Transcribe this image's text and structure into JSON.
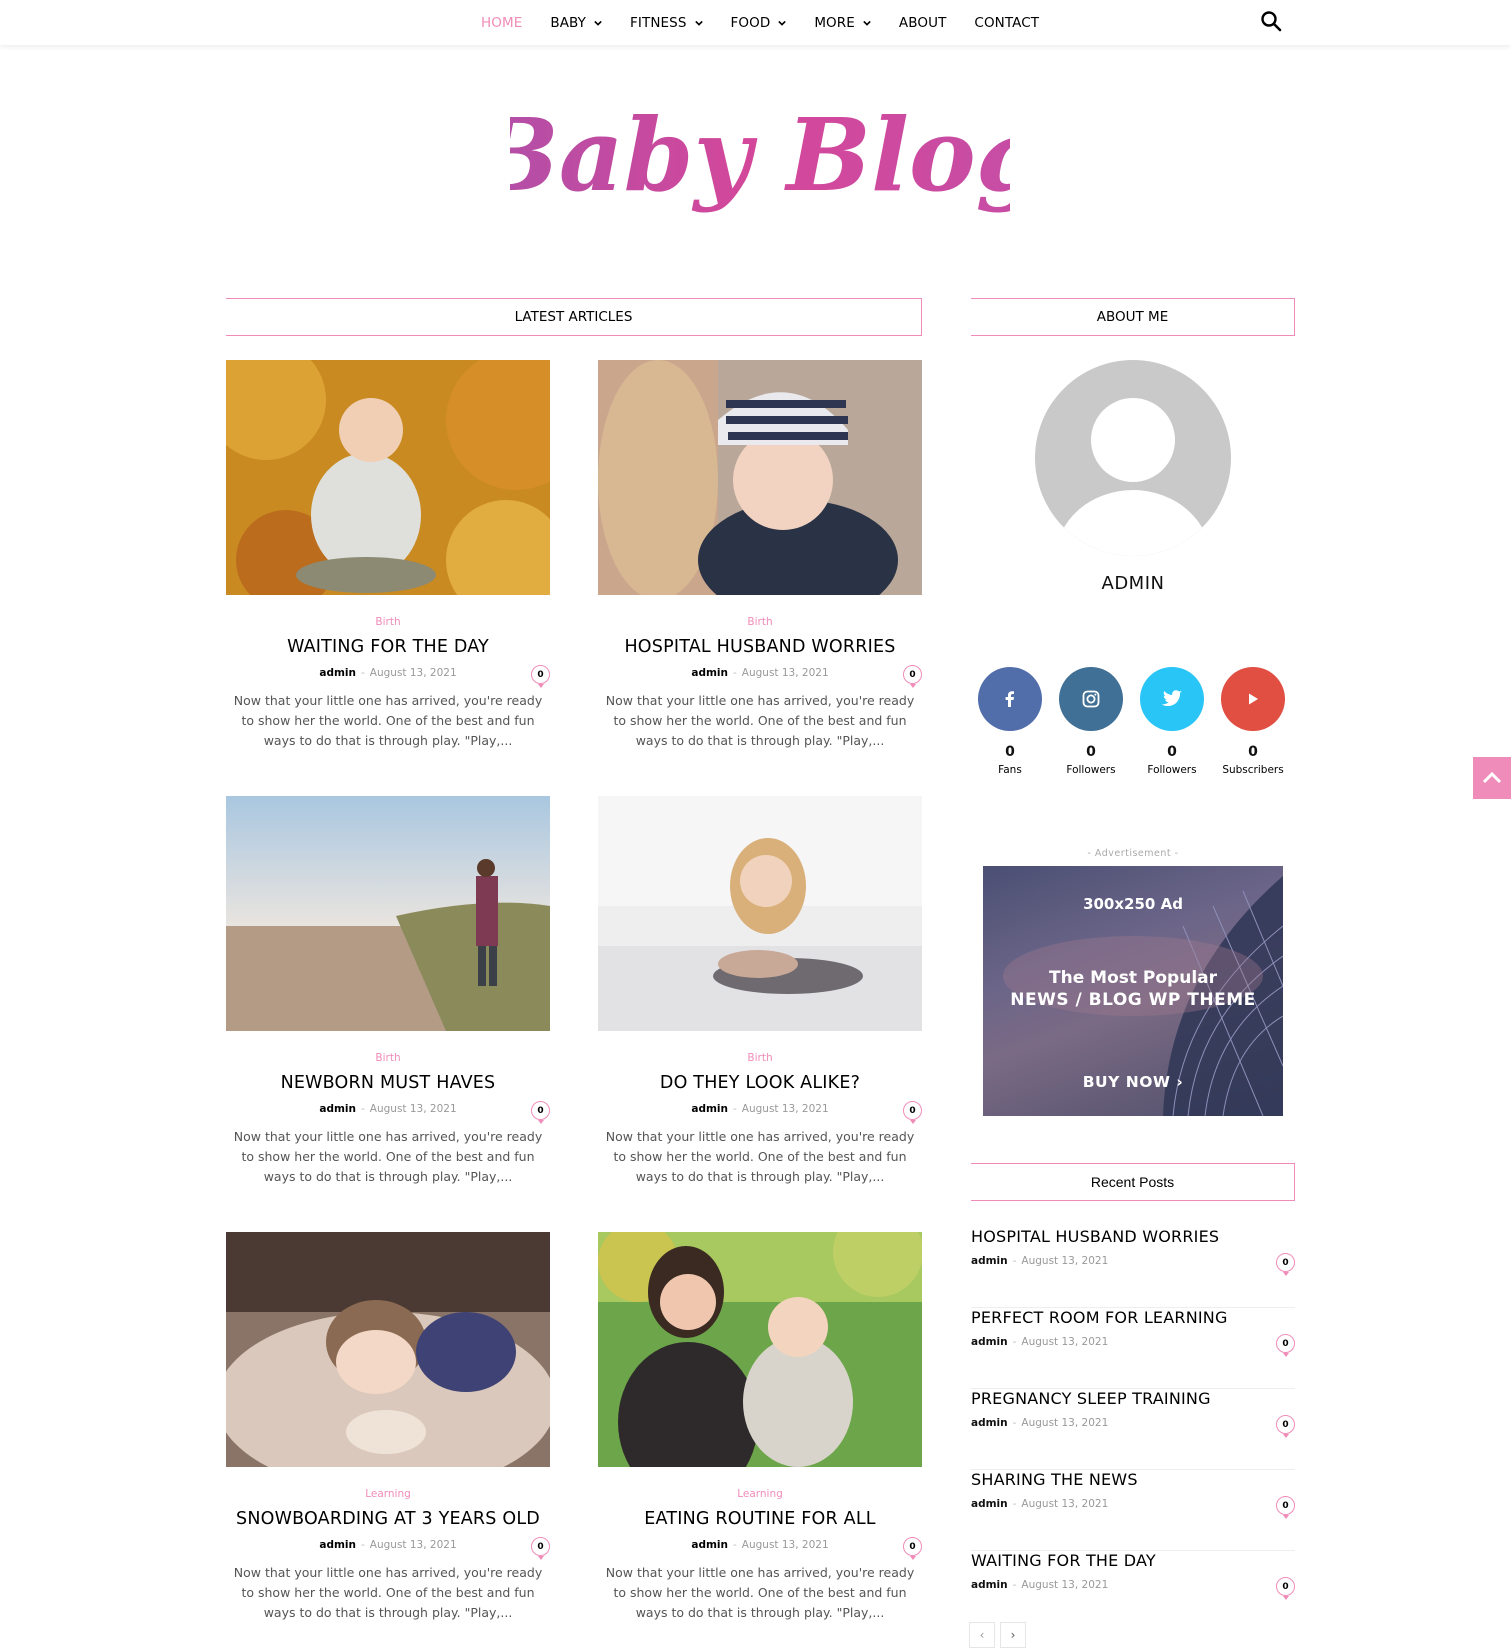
{
  "nav": {
    "items": [
      {
        "label": "HOME",
        "active": true,
        "dropdown": false
      },
      {
        "label": "BABY",
        "active": false,
        "dropdown": true
      },
      {
        "label": "FITNESS",
        "active": false,
        "dropdown": true
      },
      {
        "label": "FOOD",
        "active": false,
        "dropdown": true
      },
      {
        "label": "MORE",
        "active": false,
        "dropdown": true
      },
      {
        "label": "ABOUT",
        "active": false,
        "dropdown": false
      },
      {
        "label": "CONTACT",
        "active": false,
        "dropdown": false
      }
    ],
    "search_icon": "search-icon"
  },
  "logo": {
    "text": "Baby Blog"
  },
  "colors": {
    "accent": "#f08cb9",
    "facebook": "#516eab",
    "instagram": "#417096",
    "twitter": "#29c5f6",
    "youtube": "#e14e42"
  },
  "latest": {
    "title": "LATEST ARTICLES",
    "articles": [
      {
        "category": "Birth",
        "title": "WAITING FOR THE DAY",
        "author": "admin",
        "date": "August 13, 2021",
        "comments": "0",
        "excerpt": "Now that your little one has arrived, you're ready to show her the world. One of the best and fun ways to do that is through play. \"Play,..."
      },
      {
        "category": "Birth",
        "title": "HOSPITAL HUSBAND WORRIES",
        "author": "admin",
        "date": "August 13, 2021",
        "comments": "0",
        "excerpt": "Now that your little one has arrived, you're ready to show her the world. One of the best and fun ways to do that is through play. \"Play,..."
      },
      {
        "category": "Birth",
        "title": "NEWBORN MUST HAVES",
        "author": "admin",
        "date": "August 13, 2021",
        "comments": "0",
        "excerpt": "Now that your little one has arrived, you're ready to show her the world. One of the best and fun ways to do that is through play. \"Play,..."
      },
      {
        "category": "Birth",
        "title": "DO THEY LOOK ALIKE?",
        "author": "admin",
        "date": "August 13, 2021",
        "comments": "0",
        "excerpt": "Now that your little one has arrived, you're ready to show her the world. One of the best and fun ways to do that is through play. \"Play,..."
      },
      {
        "category": "Learning",
        "title": "SNOWBOARDING AT 3 YEARS OLD",
        "author": "admin",
        "date": "August 13, 2021",
        "comments": "0",
        "excerpt": "Now that your little one has arrived, you're ready to show her the world. One of the best and fun ways to do that is through play. \"Play,..."
      },
      {
        "category": "Learning",
        "title": "EATING ROUTINE FOR ALL",
        "author": "admin",
        "date": "August 13, 2021",
        "comments": "0",
        "excerpt": "Now that your little one has arrived, you're ready to show her the world. One of the best and fun ways to do that is through play. \"Play,..."
      }
    ]
  },
  "about": {
    "title": "ABOUT ME",
    "name": "ADMIN",
    "social": [
      {
        "icon": "facebook-icon",
        "count": "0",
        "label": "Fans"
      },
      {
        "icon": "instagram-icon",
        "count": "0",
        "label": "Followers"
      },
      {
        "icon": "twitter-icon",
        "count": "0",
        "label": "Followers"
      },
      {
        "icon": "youtube-icon",
        "count": "0",
        "label": "Subscribers"
      }
    ]
  },
  "ad": {
    "label": "- Advertisement -",
    "size": "300x250 Ad",
    "line1": "The Most Popular",
    "line2": "NEWS / BLOG WP THEME",
    "cta": "BUY NOW ›"
  },
  "recent": {
    "title": "Recent Posts",
    "posts": [
      {
        "title": "HOSPITAL HUSBAND WORRIES",
        "author": "admin",
        "date": "August 13, 2021",
        "comments": "0"
      },
      {
        "title": "PERFECT ROOM FOR LEARNING",
        "author": "admin",
        "date": "August 13, 2021",
        "comments": "0"
      },
      {
        "title": "PREGNANCY SLEEP TRAINING",
        "author": "admin",
        "date": "August 13, 2021",
        "comments": "0"
      },
      {
        "title": "SHARING THE NEWS",
        "author": "admin",
        "date": "August 13, 2021",
        "comments": "0"
      },
      {
        "title": "WAITING FOR THE DAY",
        "author": "admin",
        "date": "August 13, 2021",
        "comments": "0"
      }
    ],
    "prev": "‹",
    "next": "›"
  },
  "meta_separator": "-"
}
